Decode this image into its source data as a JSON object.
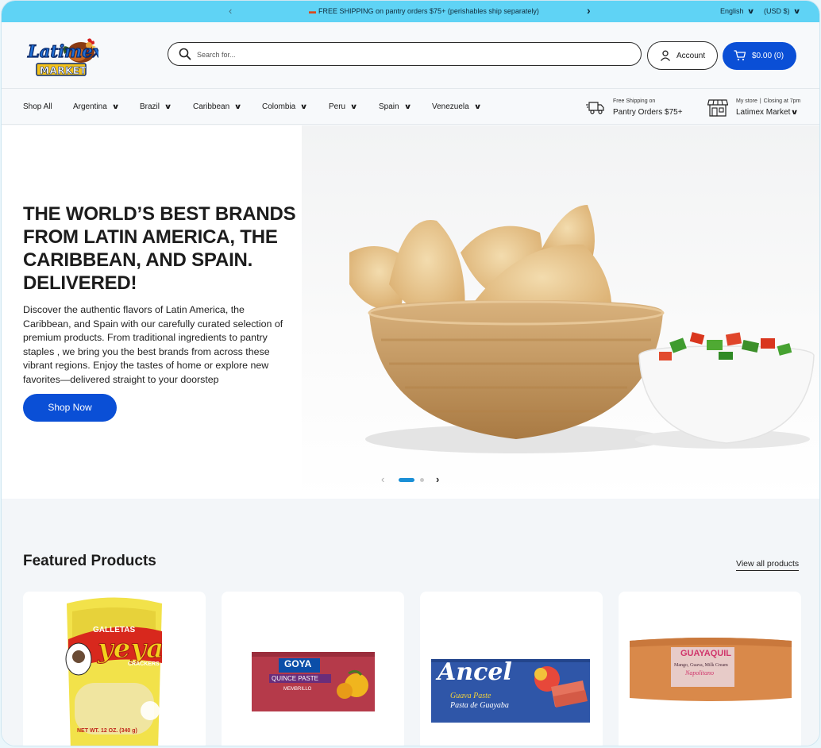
{
  "announcement": {
    "message": "FREE SHIPPING on pantry orders $75+ (perishables ship separately)",
    "prev_icon": "chevron-left-icon",
    "next_icon": "chevron-right-icon",
    "language": "English",
    "currency": "(USD $)"
  },
  "header": {
    "logo_text_top": "Latimex",
    "logo_text_bottom": "MARKET",
    "search_placeholder": "Search for...",
    "account_label": "Account",
    "cart_label": "$0.00 (0)"
  },
  "nav": {
    "items": [
      {
        "label": "Shop All",
        "dropdown": false
      },
      {
        "label": "Argentina",
        "dropdown": true
      },
      {
        "label": "Brazil",
        "dropdown": true
      },
      {
        "label": "Caribbean",
        "dropdown": true
      },
      {
        "label": "Colombia",
        "dropdown": true
      },
      {
        "label": "Peru",
        "dropdown": true
      },
      {
        "label": "Spain",
        "dropdown": true
      },
      {
        "label": "Venezuela",
        "dropdown": true
      }
    ],
    "shipping_small": "Free Shipping on",
    "shipping_main": "Pantry Orders $75+",
    "store_small_1": "My store",
    "store_small_2": "Closing at 7pm",
    "store_main": "Latimex Market"
  },
  "hero": {
    "title": "THE WORLD’S BEST BRANDS FROM LATIN AMERICA, THE CARIBBEAN, AND SPAIN. DELIVERED!",
    "description": "Discover the authentic flavors of Latin America, the Caribbean, and Spain with our carefully curated selection of premium products. From traditional ingredients to pantry staples , we bring you the best brands from across these vibrant regions. Enjoy the tastes of home or explore new favorites—delivered straight to your doorstep",
    "cta": "Shop Now",
    "slide_count": 2,
    "active_slide": 1
  },
  "featured": {
    "title": "Featured Products",
    "view_all": "View all products",
    "products": [
      {
        "brand": "GALLETAS",
        "name": "yeya",
        "sub": "CRACKERS",
        "weight": "NET WT. 12 OZ. (340 g)"
      },
      {
        "brand": "GOYA",
        "name": "QUINCE PASTE",
        "sub": "MEMBRILLO"
      },
      {
        "brand": "Ancel",
        "name": "Guava Paste",
        "sub": "Pasta de Guayaba"
      },
      {
        "brand": "GUAYAQUIL",
        "name": "Mango, Guava, Milk Cream",
        "sub": "Napolitano"
      }
    ]
  },
  "colors": {
    "announcement_bg": "#5fd3f5",
    "primary_button": "#0a4fd6",
    "slider_active": "#1a8fd6"
  }
}
